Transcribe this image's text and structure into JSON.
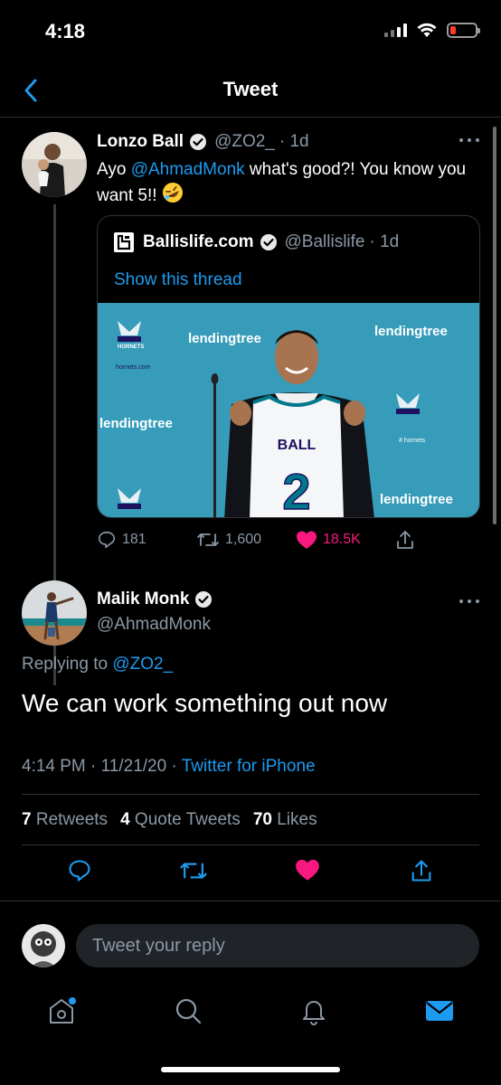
{
  "status_bar": {
    "time": "4:18"
  },
  "header": {
    "title": "Tweet"
  },
  "parent_tweet": {
    "name": "Lonzo Ball",
    "handle": "@ZO2_",
    "age": "· 1d",
    "text_prefix": "Ayo ",
    "mention": "@AhmadMonk",
    "text_suffix": " what's good?! You know you want 5!!",
    "quote": {
      "name": "Ballislife.com",
      "handle": "@Ballislife",
      "age": "· 1d",
      "show_thread": "Show this thread",
      "image": {
        "banner_word": "lendingtree",
        "team_word": "HORNETS",
        "web_word": "hornets.com",
        "hashtag_word": "# hornets",
        "jersey_name": "BALL",
        "jersey_number": "2"
      }
    },
    "actions": {
      "replies": "181",
      "retweets": "1,600",
      "likes": "18.5K"
    }
  },
  "main_tweet": {
    "name": "Malik Monk",
    "handle": "@AhmadMonk",
    "replying_label": "Replying to ",
    "replying_to": "@ZO2_",
    "text": "We can work something out now",
    "time": "4:14 PM · 11/21/20 · ",
    "source": "Twitter for iPhone",
    "stats": {
      "retweets_count": "7",
      "retweets_label": "Retweets",
      "quotes_count": "4",
      "quotes_label": "Quote Tweets",
      "likes_count": "70",
      "likes_label": "Likes"
    }
  },
  "reply": {
    "placeholder": "Tweet your reply"
  },
  "colors": {
    "accent": "#1d9bf0",
    "like": "#f91880",
    "background": "#000000"
  },
  "tabs": [
    "home-icon",
    "search-icon",
    "notifications-icon",
    "messages-icon"
  ]
}
